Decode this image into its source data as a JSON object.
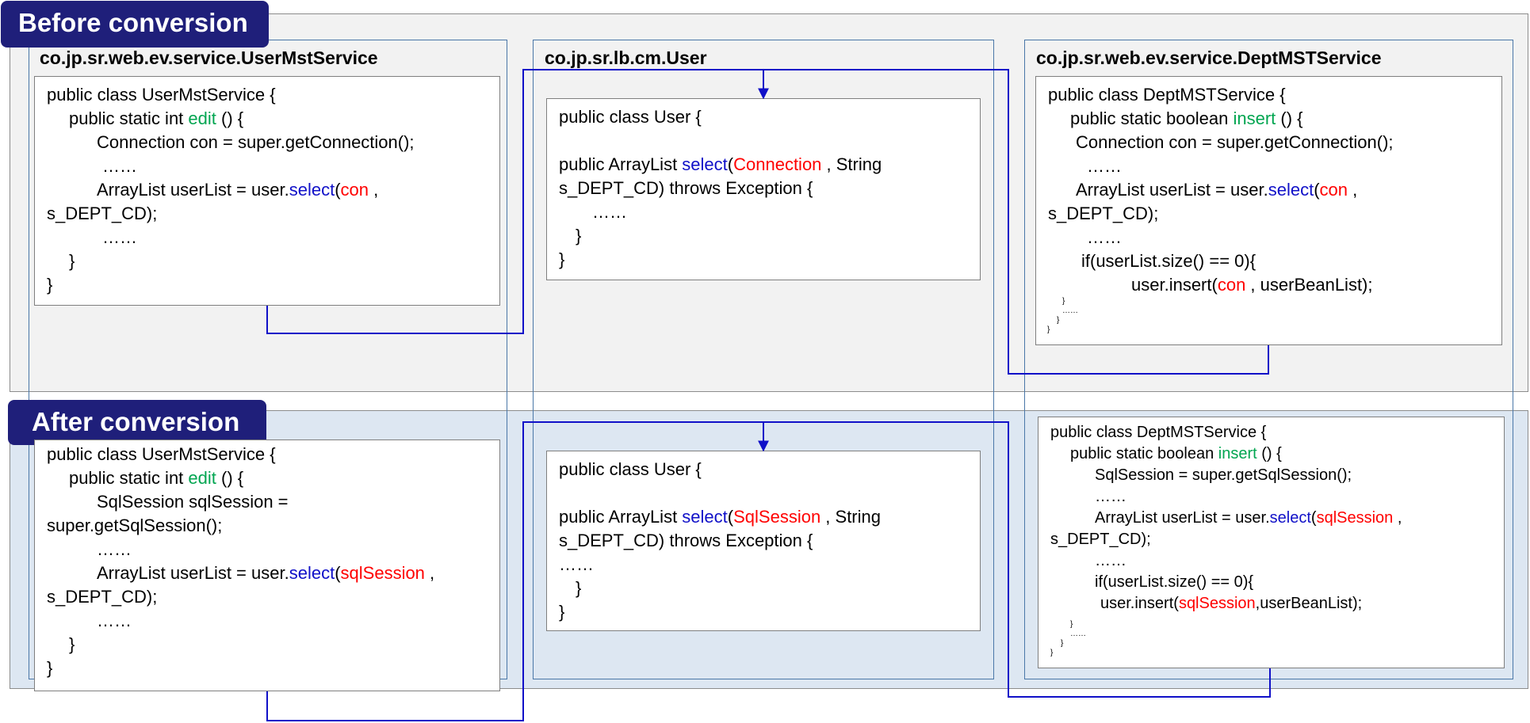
{
  "labels": {
    "before": "Before conversion",
    "after": "After conversion"
  },
  "classes": {
    "user_mst": "co.jp.sr.web.ev.service.UserMstService",
    "user": "co.jp.sr.lb.cm.User",
    "dept_mst": "co.jp.sr.web.ev.service.DeptMSTService"
  },
  "colors": {
    "method_name": "#00a550",
    "call_name": "#1010c8",
    "argument": "#ff0000",
    "arrow": "#1010c8",
    "badge": "#1f1f7a"
  },
  "code": {
    "before_user_mst": {
      "l1": "public class UserMstService {",
      "l2a": "public static int ",
      "l2b": "edit",
      "l2c": " () {",
      "l3": "Connection con = super.getConnection();",
      "l4": "……",
      "l5a": "ArrayList userList = user.",
      "l5b": "select",
      "l5c": "(",
      "l5d": "con",
      "l5e": " ,",
      "l6": "s_DEPT_CD);",
      "l7": "……",
      "l8": "}",
      "l9": "}"
    },
    "before_user": {
      "l1": "public class User {",
      "l2a": "public ArrayList ",
      "l2b": "select",
      "l2c": "(",
      "l2d": "Connection",
      "l2e": " , String",
      "l3": "s_DEPT_CD) throws Exception {",
      "l4": "……",
      "l5": "}",
      "l6": "}"
    },
    "before_dept": {
      "l1": "public class DeptMSTService {",
      "l2a": "public static boolean ",
      "l2b": "insert",
      "l2c": " () {",
      "l3": "Connection con = super.getConnection();",
      "l4": "……",
      "l5a": "ArrayList userList = user.",
      "l5b": "select",
      "l5c": "(",
      "l5d": "con",
      "l5e": " ,",
      "l6": "s_DEPT_CD);",
      "l7": "……",
      "l8": "if(userList.size() == 0){",
      "l9a": "user.insert(",
      "l9b": "con",
      "l9c": " , userBeanList);",
      "l10": "}",
      "l11": "……",
      "l12": "}",
      "l13": "}"
    },
    "after_user_mst": {
      "l1": "public class UserMstService {",
      "l2a": "public static int ",
      "l2b": "edit",
      "l2c": " () {",
      "l3": "SqlSession sqlSession =",
      "l4": "super.getSqlSession();",
      "l5": "……",
      "l6a": "ArrayList userList = user.",
      "l6b": "select",
      "l6c": "(",
      "l6d": "sqlSession",
      "l6e": " ,",
      "l7": "s_DEPT_CD);",
      "l8": "……",
      "l9": "}",
      "l10": "}"
    },
    "after_user": {
      "l1": "public class User {",
      "l2a": "public ArrayList ",
      "l2b": "select",
      "l2c": "(",
      "l2d": "SqlSession",
      "l2e": " , String",
      "l3": "s_DEPT_CD) throws Exception {",
      "l4": "……",
      "l5": "}",
      "l6": "}"
    },
    "after_dept": {
      "l1": "public class DeptMSTService {",
      "l2a": "public static boolean ",
      "l2b": "insert",
      "l2c": " () {",
      "l3": "SqlSession = super.getSqlSession();",
      "l4": "……",
      "l5a": "ArrayList userList = user.",
      "l5b": "select",
      "l5c": "(",
      "l5d": "sqlSession",
      "l5e": " ,",
      "l6": "s_DEPT_CD);",
      "l7": "……",
      "l8": "if(userList.size() == 0){",
      "l9a": "user.insert(",
      "l9b": "sqlSession",
      "l9c": ",userBeanList);",
      "l10": "}",
      "l11": "……",
      "l12": "}",
      "l13": "}"
    }
  }
}
